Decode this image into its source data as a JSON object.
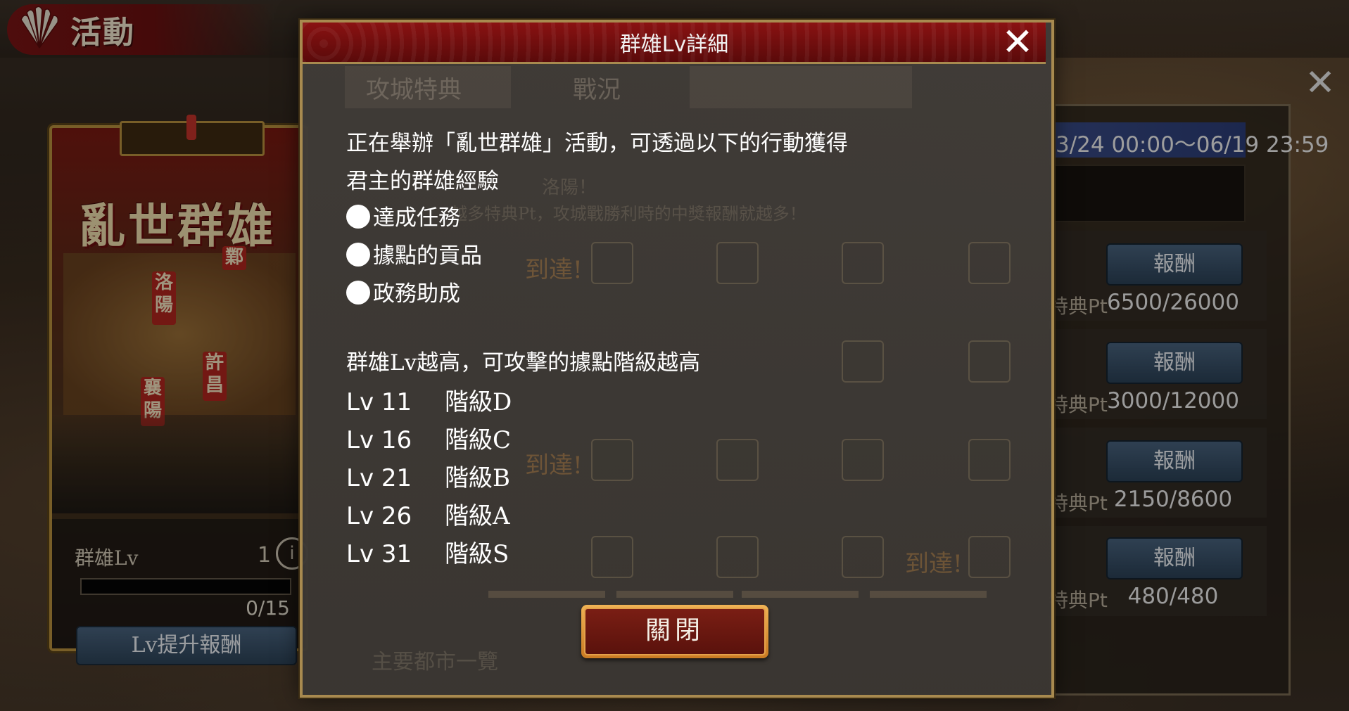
{
  "header": {
    "title": "活動"
  },
  "event_card": {
    "poster_title": "亂世群雄",
    "map_labels": [
      "洛陽",
      "許昌",
      "襄陽",
      "鄴"
    ],
    "lv_label": "群雄Lv",
    "lv_value": "1",
    "lv_progress_fraction": 0,
    "lv_progress": "0/15",
    "reward_button": "Lv提升報酬",
    "info_icon": "i"
  },
  "right_panel": {
    "date_range": "3/24 00:00～06/19 23:59",
    "rewards": [
      {
        "button": "報酬",
        "label": "特典Pt",
        "value": "6500/26000"
      },
      {
        "button": "報酬",
        "label": "特典Pt",
        "value": "3000/12000"
      },
      {
        "button": "報酬",
        "label": "特典Pt",
        "value": "2150/8600"
      },
      {
        "button": "報酬",
        "label": "特典Pt",
        "value": "480/480"
      }
    ]
  },
  "background_tabs": [
    "攻城特典",
    "戰況"
  ],
  "background_texts": [
    "洛陽！",
    "越多特典Pt，攻城戰勝利時的中獎報酬就越多！",
    "到達!",
    "主要都市一覽"
  ],
  "modal": {
    "title": "群雄Lv詳細",
    "intro_line1": "正在舉辦「亂世群雄」活動，可透過以下的行動獲得",
    "intro_line2": "君主的群雄經驗",
    "bullets": [
      "達成任務",
      "據點的貢品",
      "政務助成"
    ],
    "rule_line": "群雄Lv越高，可攻擊的據點階級越高",
    "levels": [
      {
        "lv": "Lv  11",
        "tier": "階級D"
      },
      {
        "lv": "Lv  16",
        "tier": "階級C"
      },
      {
        "lv": "Lv  21",
        "tier": "階級B"
      },
      {
        "lv": "Lv  26",
        "tier": "階級A"
      },
      {
        "lv": "Lv  31",
        "tier": "階級S"
      }
    ],
    "close_button": "關閉",
    "close_icon": "✕"
  },
  "outer_close_icon": "✕",
  "icons": {
    "header": "fan-icon",
    "close": "close-icon",
    "info": "info-icon"
  },
  "colors": {
    "accent_red": "#8a1212",
    "gold_border": "#a88a4f",
    "button_blue": "#3b5570"
  }
}
